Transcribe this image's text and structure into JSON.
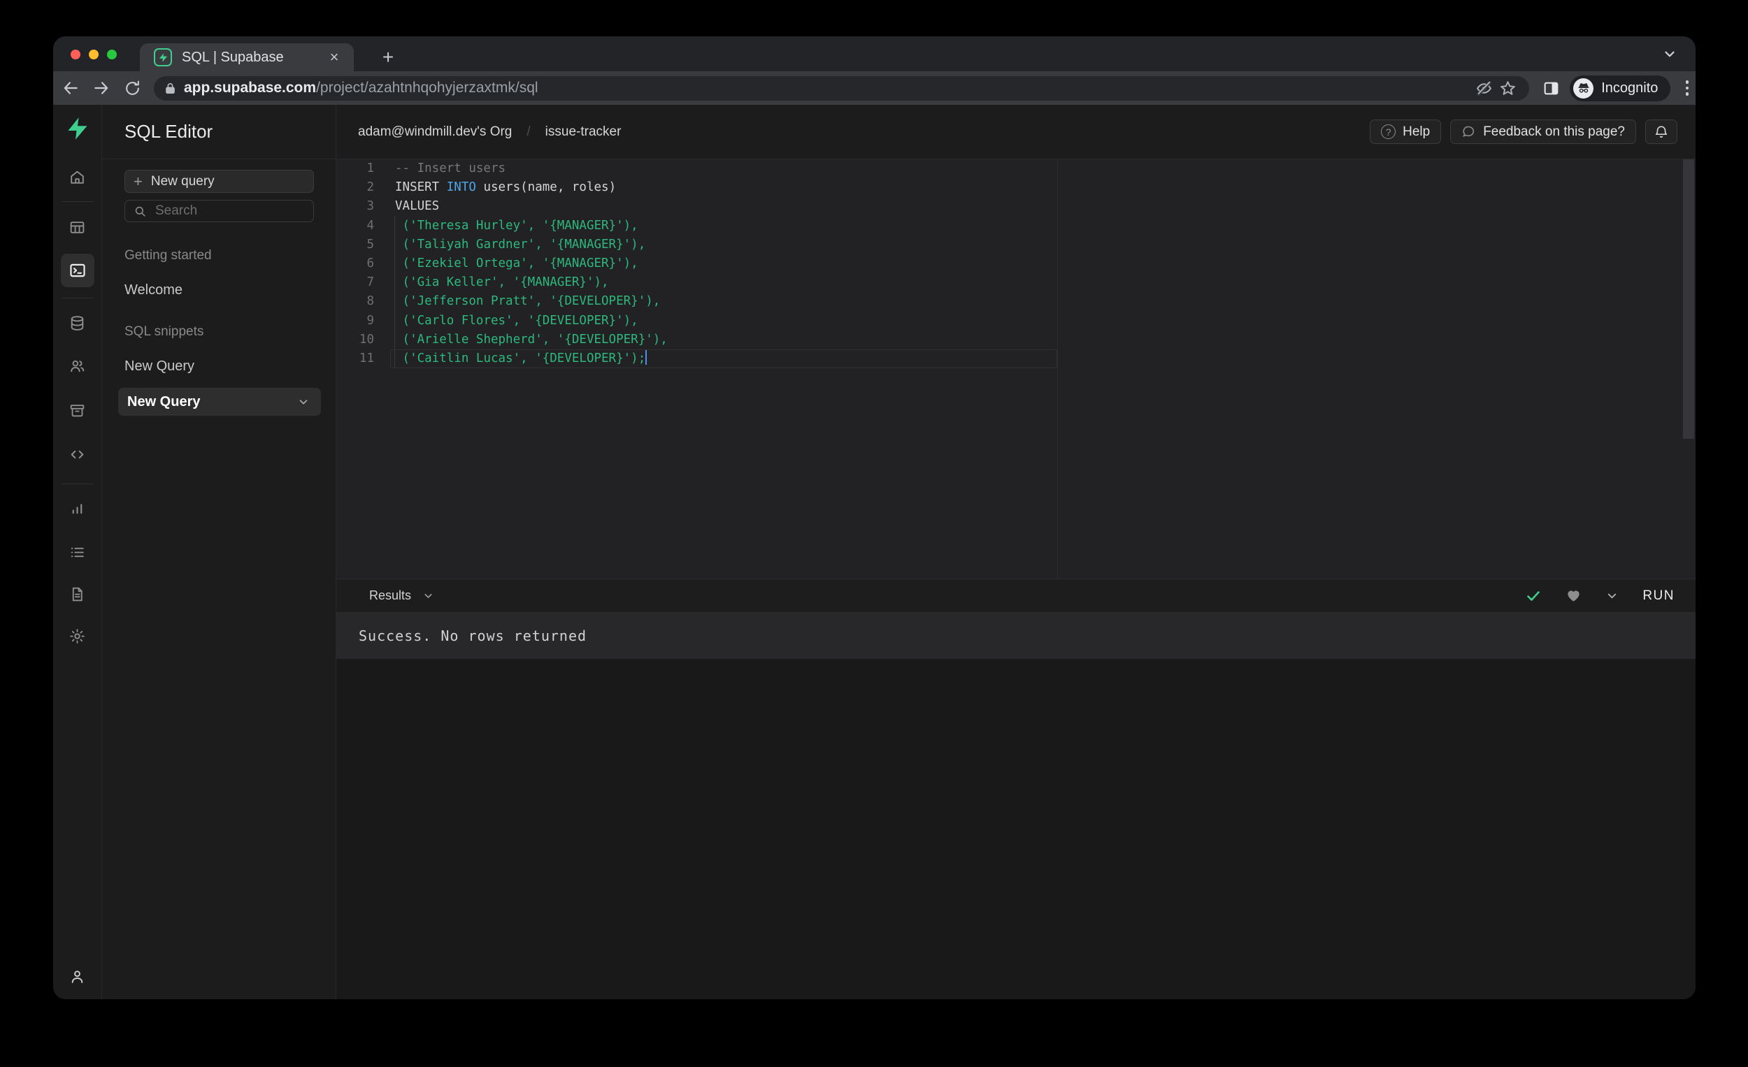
{
  "browser": {
    "tab_title": "SQL | Supabase",
    "url_domain": "app.supabase.com",
    "url_path": "/project/azahtnhqohyjerzaxtmk/sql",
    "incognito_label": "Incognito",
    "close_glyph": "×",
    "newtab_glyph": "+"
  },
  "colors": {
    "accent_green": "#3ecf8e",
    "code_string_green": "#2db87e",
    "code_keyword_blue": "#4fa6e8",
    "status_check_green": "#3ecf8e"
  },
  "sidebar": {
    "title": "SQL Editor",
    "new_query_button": "New query",
    "search_placeholder": "Search",
    "sections": [
      {
        "label": "Getting started",
        "items": [
          "Welcome"
        ]
      },
      {
        "label": "SQL snippets",
        "items": [
          "New Query"
        ]
      }
    ],
    "selected_item": "New Query"
  },
  "header": {
    "breadcrumb_org": "adam@windmill.dev's Org",
    "breadcrumb_sep": "/",
    "breadcrumb_project": "issue-tracker",
    "help_label": "Help",
    "help_glyph": "?",
    "feedback_label": "Feedback on this page?"
  },
  "editor": {
    "lines": [
      {
        "num": 1,
        "segments": [
          {
            "t": "-- Insert users",
            "c": "comment"
          }
        ]
      },
      {
        "num": 2,
        "segments": [
          {
            "t": "INSERT ",
            "c": "plain"
          },
          {
            "t": "INTO",
            "c": "keyword"
          },
          {
            "t": " users(name, roles)",
            "c": "plain"
          }
        ]
      },
      {
        "num": 3,
        "segments": [
          {
            "t": "VALUES",
            "c": "plain"
          }
        ]
      },
      {
        "num": 4,
        "guide": true,
        "segments": [
          {
            "t": " ",
            "c": "plain"
          },
          {
            "t": "('Theresa Hurley', '{MANAGER}'),",
            "c": "string"
          }
        ]
      },
      {
        "num": 5,
        "guide": true,
        "segments": [
          {
            "t": " ",
            "c": "plain"
          },
          {
            "t": "('Taliyah Gardner', '{MANAGER}'),",
            "c": "string"
          }
        ]
      },
      {
        "num": 6,
        "guide": true,
        "segments": [
          {
            "t": " ",
            "c": "plain"
          },
          {
            "t": "('Ezekiel Ortega', '{MANAGER}'),",
            "c": "string"
          }
        ]
      },
      {
        "num": 7,
        "guide": true,
        "segments": [
          {
            "t": " ",
            "c": "plain"
          },
          {
            "t": "('Gia Keller', '{MANAGER}'),",
            "c": "string"
          }
        ]
      },
      {
        "num": 8,
        "guide": true,
        "segments": [
          {
            "t": " ",
            "c": "plain"
          },
          {
            "t": "('Jefferson Pratt', '{DEVELOPER}'),",
            "c": "string"
          }
        ]
      },
      {
        "num": 9,
        "guide": true,
        "segments": [
          {
            "t": " ",
            "c": "plain"
          },
          {
            "t": "('Carlo Flores', '{DEVELOPER}'),",
            "c": "string"
          }
        ]
      },
      {
        "num": 10,
        "guide": true,
        "segments": [
          {
            "t": " ",
            "c": "plain"
          },
          {
            "t": "('Arielle Shepherd', '{DEVELOPER}'),",
            "c": "string"
          }
        ]
      },
      {
        "num": 11,
        "guide": true,
        "current": true,
        "cursor": true,
        "segments": [
          {
            "t": " ",
            "c": "plain"
          },
          {
            "t": "('Caitlin Lucas', '{DEVELOPER}');",
            "c": "string"
          }
        ]
      }
    ]
  },
  "results": {
    "tab_label": "Results",
    "run_label": "RUN",
    "message": "Success. No rows returned"
  }
}
